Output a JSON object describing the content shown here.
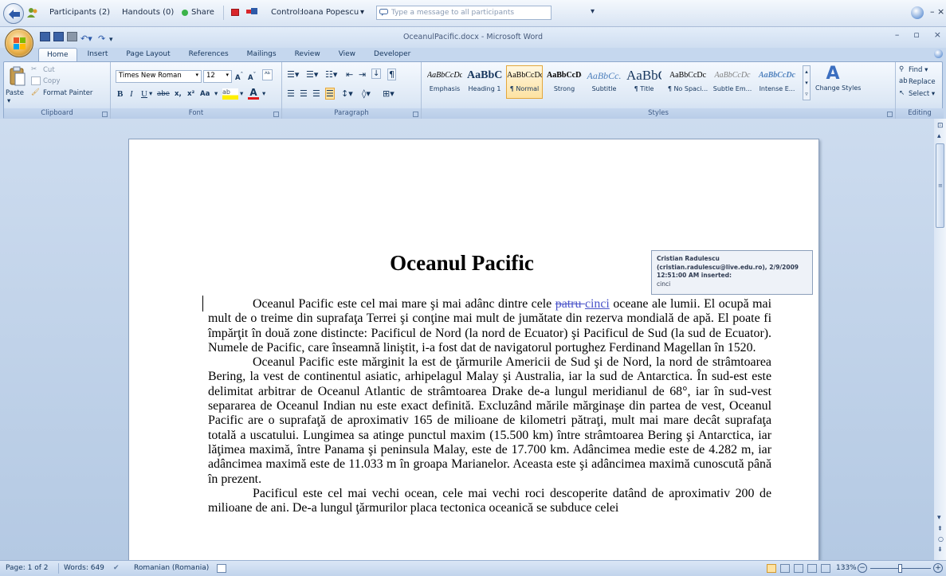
{
  "meeting_bar": {
    "participants": "Participants (2)",
    "handouts": "Handouts (0)",
    "share": "Share",
    "control_label": "Control:",
    "controller": "Ioana Popescu",
    "message_placeholder": "Type a message to all participants"
  },
  "window": {
    "title": "OceanulPacific.docx - Microsoft Word"
  },
  "tabs": [
    "Home",
    "Insert",
    "Page Layout",
    "References",
    "Mailings",
    "Review",
    "View",
    "Developer"
  ],
  "ribbon": {
    "clipboard": {
      "label": "Clipboard",
      "paste": "Paste",
      "cut": "Cut",
      "copy": "Copy",
      "format_painter": "Format Painter"
    },
    "font": {
      "label": "Font",
      "family": "Times New Roman",
      "size": "12",
      "aa": "Aa"
    },
    "paragraph": {
      "label": "Paragraph"
    },
    "styles": {
      "label": "Styles",
      "items": [
        {
          "preview": "AaBbCcDc",
          "name": "Emphasis"
        },
        {
          "preview": "AaBbC(",
          "name": "Heading 1"
        },
        {
          "preview": "AaBbCcDc",
          "name": "¶ Normal"
        },
        {
          "preview": "AaBbCcDd",
          "name": "Strong"
        },
        {
          "preview": "AaBbCc.",
          "name": "Subtitle"
        },
        {
          "preview": "AaBbC",
          "name": "¶ Title"
        },
        {
          "preview": "AaBbCcDc",
          "name": "¶ No Spaci..."
        },
        {
          "preview": "AaBbCcDc",
          "name": "Subtle Em..."
        },
        {
          "preview": "AaBbCcDc",
          "name": "Intense E..."
        }
      ],
      "change_styles": "Change Styles"
    },
    "editing": {
      "label": "Editing",
      "find": "Find",
      "replace": "Replace",
      "select": "Select"
    }
  },
  "document": {
    "title": "Oceanul Pacific",
    "p1_before": "Oceanul Pacific este cel mai mare şi mai adânc dintre cele ",
    "p1_deleted": "patru ",
    "p1_inserted": "cinci",
    "p1_after": " oceane ale lumii. El ocupă mai mult de o treime din suprafaţa Terrei şi conţine mai mult de jumătate din rezerva mondială de apă. El poate fi împărţit în două zone distincte: Pacificul de Nord (la nord de Ecuator) şi Pacificul de Sud (la sud de Ecuator). Numele de Pacific, care înseamnă liniştit, i-a fost dat de navigatorul portughez Ferdinand Magellan în 1520.",
    "p2": "Oceanul Pacific este mărginit la est de ţărmurile Americii de Sud şi de Nord, la nord de strâmtoarea Bering, la vest de continentul asiatic, arhipelagul Malay şi Australia, iar la sud de Antarctica. În sud-est este delimitat arbitrar de Oceanul Atlantic de strâmtoarea Drake de-a lungul meridianul de 68°, iar în sud-vest separarea de Oceanul Indian nu este exact definită. Excluzând mările mărginaşe din partea de vest, Oceanul Pacific are o suprafaţă de aproximativ 165 de milioane de kilometri pătraţi, mult mai mare decât suprafaţa totală a uscatului. Lungimea sa atinge punctul maxim (15.500 km) între strâmtoarea Bering şi Antarctica, iar lăţimea maximă, între Panama şi peninsula Malay, este de 17.700 km. Adâncimea medie este de 4.282 m, iar adâncimea maximă este de 11.033 m în groapa Marianelor. Aceasta este şi adâncimea maximă cunoscută până în prezent.",
    "p3": "Pacificul este cel mai vechi ocean, cele mai vechi roci descoperite datând de aproximativ 200 de milioane de ani. De-a lungul ţărmurilor placa tectonica oceanică se subduce celei"
  },
  "comment": {
    "author": "Cristian Radulescu",
    "details": "(cristian.radulescu@live.edu.ro), 2/9/2009 12:51:00 AM inserted:",
    "text": "cinci"
  },
  "status": {
    "page": "Page: 1 of 2",
    "words": "Words: 649",
    "language": "Romanian (Romania)",
    "zoom": "133%"
  }
}
